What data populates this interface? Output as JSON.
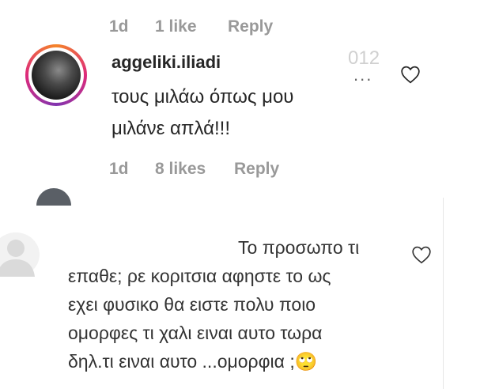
{
  "top_meta": {
    "time": "1d",
    "likes": "1 like",
    "reply": "Reply"
  },
  "comment1": {
    "username": "aggeliki.iliadi",
    "faded_number": "012",
    "more": "...",
    "text": "τους μιλάω όπως μου μιλάνε απλά!!!",
    "time": "1d",
    "likes": "8 likes",
    "reply": "Reply"
  },
  "comment2": {
    "lines": [
      "Το προσωπο τι",
      "επαθε; ρε κοριτσια αφηστε το ως",
      "εχει φυσικο θα ειστε πολυ ποιο",
      "ομορφες τι χαλι ειναι αυτο τωρα",
      "δηλ.τι ειναι αυτο ...ομορφια ;🙄"
    ]
  },
  "icons": {
    "heart_top": "heart-outline-icon",
    "heart_bottom": "heart-outline-icon",
    "default_avatar": "default-avatar-icon"
  },
  "colors": {
    "story_ring": "#dd2a7b",
    "meta_gray": "#999999"
  }
}
